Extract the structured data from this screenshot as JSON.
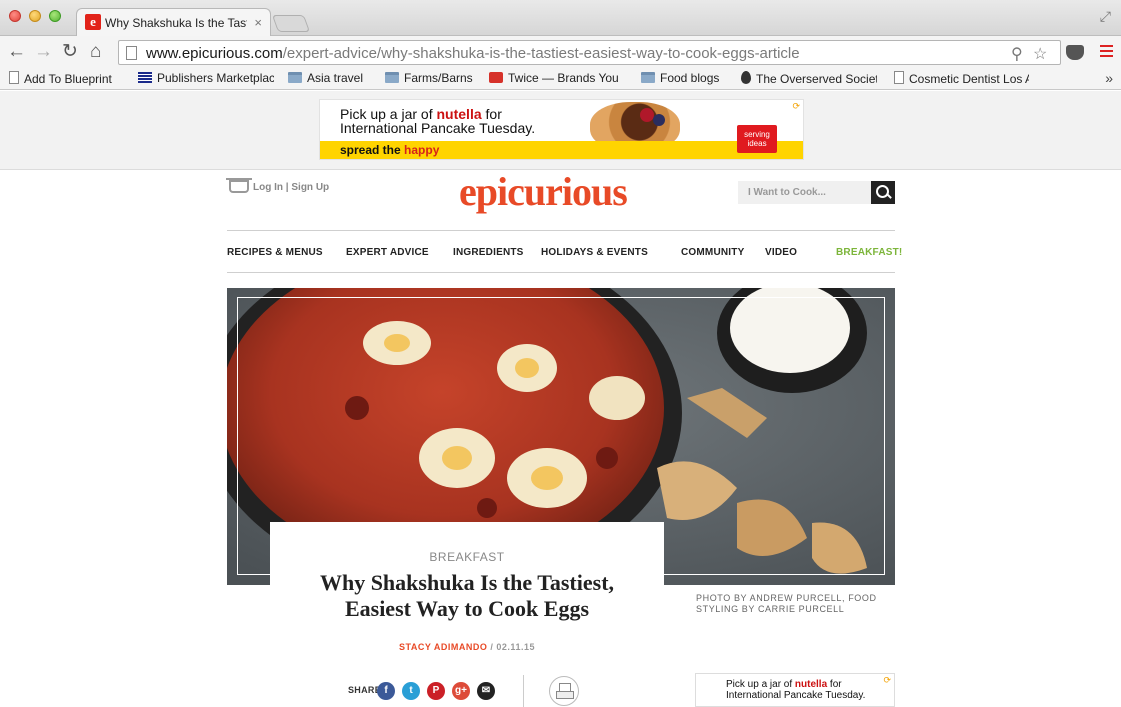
{
  "browser": {
    "tab_title": "Why Shakshuka Is the Tastiest, Easiest Way to Cook Eggs",
    "tab_close": "×",
    "url_host": "www.epicurious.com",
    "url_path": "/expert-advice/why-shakshuka-is-the-tastiest-easiest-way-to-cook-eggs-article",
    "back": "←",
    "forward": "→",
    "reload": "↻",
    "home": "⌂",
    "zoom_glyph": "⚲",
    "star_glyph": "☆",
    "fullscreen_glyph": "⤢",
    "bookmarks_more": "»",
    "bookmarks": [
      {
        "label": "Add To Blueprint",
        "icon": "page-icon"
      },
      {
        "label": "Publishers Marketplace",
        "icon": "flag-icon"
      },
      {
        "label": "Asia travel",
        "icon": "folder-icon"
      },
      {
        "label": "Farms/Barns",
        "icon": "folder-icon"
      },
      {
        "label": "Twice — Brands You Love",
        "icon": "twice-icon"
      },
      {
        "label": "Food blogs",
        "icon": "folder-icon"
      },
      {
        "label": "The Overserved Society",
        "icon": "drop-icon"
      },
      {
        "label": "Cosmetic Dentist Los Angeles",
        "icon": "page-icon"
      }
    ]
  },
  "ad_top": {
    "line1_pre": "Pick up a jar of ",
    "brand": "nutella",
    "line1_post": " for",
    "line2": "International Pancake Tuesday.",
    "tagline_pre": "spread the ",
    "tagline_happy": "happy",
    "cta": "serving ideas",
    "adchoice": "⟳"
  },
  "header": {
    "login": "Log In",
    "separator": "|",
    "signup": "Sign Up",
    "logo": "epicurious",
    "search_placeholder": "I Want to Cook..."
  },
  "nav": [
    {
      "label": "RECIPES & MENUS"
    },
    {
      "label": "EXPERT ADVICE"
    },
    {
      "label": "INGREDIENTS"
    },
    {
      "label": "HOLIDAYS & EVENTS"
    },
    {
      "label": "COMMUNITY"
    },
    {
      "label": "VIDEO"
    },
    {
      "label": "BREAKFAST!",
      "accent": "#7cb53a"
    }
  ],
  "article": {
    "category": "BREAKFAST",
    "headline": "Why Shakshuka Is the Tastiest, Easiest Way to Cook Eggs",
    "author": "STACY ADIMANDO",
    "date_sep": "/",
    "date": "02.11.15",
    "photo_credit": "PHOTO BY ANDREW PURCELL, FOOD STYLING BY CARRIE PURCELL"
  },
  "share": {
    "label": "SHARE",
    "icons": [
      {
        "name": "facebook-icon",
        "glyph": "f",
        "color": "#3b5998"
      },
      {
        "name": "twitter-icon",
        "glyph": "t",
        "color": "#2a9fd6"
      },
      {
        "name": "pinterest-icon",
        "glyph": "P",
        "color": "#cb2027"
      },
      {
        "name": "google-plus-icon",
        "glyph": "g+",
        "color": "#dd4b39"
      },
      {
        "name": "email-icon",
        "glyph": "✉",
        "color": "#222222"
      }
    ]
  },
  "ad_side": {
    "line1_pre": "Pick up a jar of ",
    "brand": "nutella",
    "line1_post": " for",
    "line2": "International Pancake Tuesday.",
    "adchoice": "⟳"
  },
  "colors": {
    "brand": "#e84a27",
    "nav_accent": "#7cb53a"
  }
}
